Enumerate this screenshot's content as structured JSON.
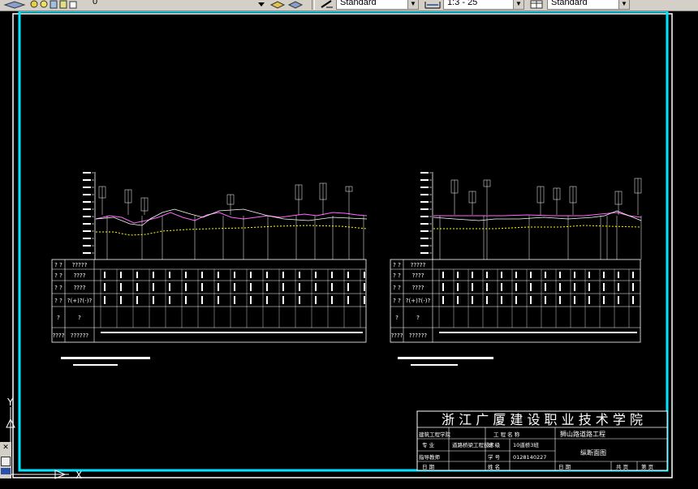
{
  "toolbar": {
    "layer_value": "0",
    "text_style": "Standard",
    "dim_scale": "1:3 - 25",
    "dim_style": "Standard"
  },
  "ucs": {
    "x_label": "X",
    "y_label": "Y"
  },
  "title_block": {
    "school": "浙 江 广 厦 建 设 职 业 技 术 学 院",
    "dept_label": "建筑工程学院",
    "project_label": "工 程 名 称",
    "project_name": "狮山路道路工程",
    "major_label": "专  业",
    "major_value": "道路桥梁工程技术",
    "class_label": "班 级",
    "class_value": "10道桥3班",
    "drawing_name": "纵断面图",
    "teacher_label": "指导教师",
    "id_label": "学 号",
    "id_value": "0128140227",
    "date_label": "日 期",
    "student_label": "姓 名",
    "date2_label": "日 期",
    "sheet_label": "共  页",
    "page_label": "第  页"
  },
  "profiles": [
    {
      "row_labels": [
        "? ?",
        "? ?",
        "? ?",
        "? ?",
        "?",
        "????"
      ],
      "row_values": [
        "?????",
        "????",
        "????",
        "?(+)?(-)?",
        "?",
        "??????"
      ]
    },
    {
      "row_labels": [
        "? ?",
        "? ?",
        "? ?",
        "? ?",
        "?",
        "????"
      ],
      "row_values": [
        "?????",
        "????",
        "????",
        "?(+)?(-)?",
        "?",
        "??????"
      ]
    }
  ]
}
